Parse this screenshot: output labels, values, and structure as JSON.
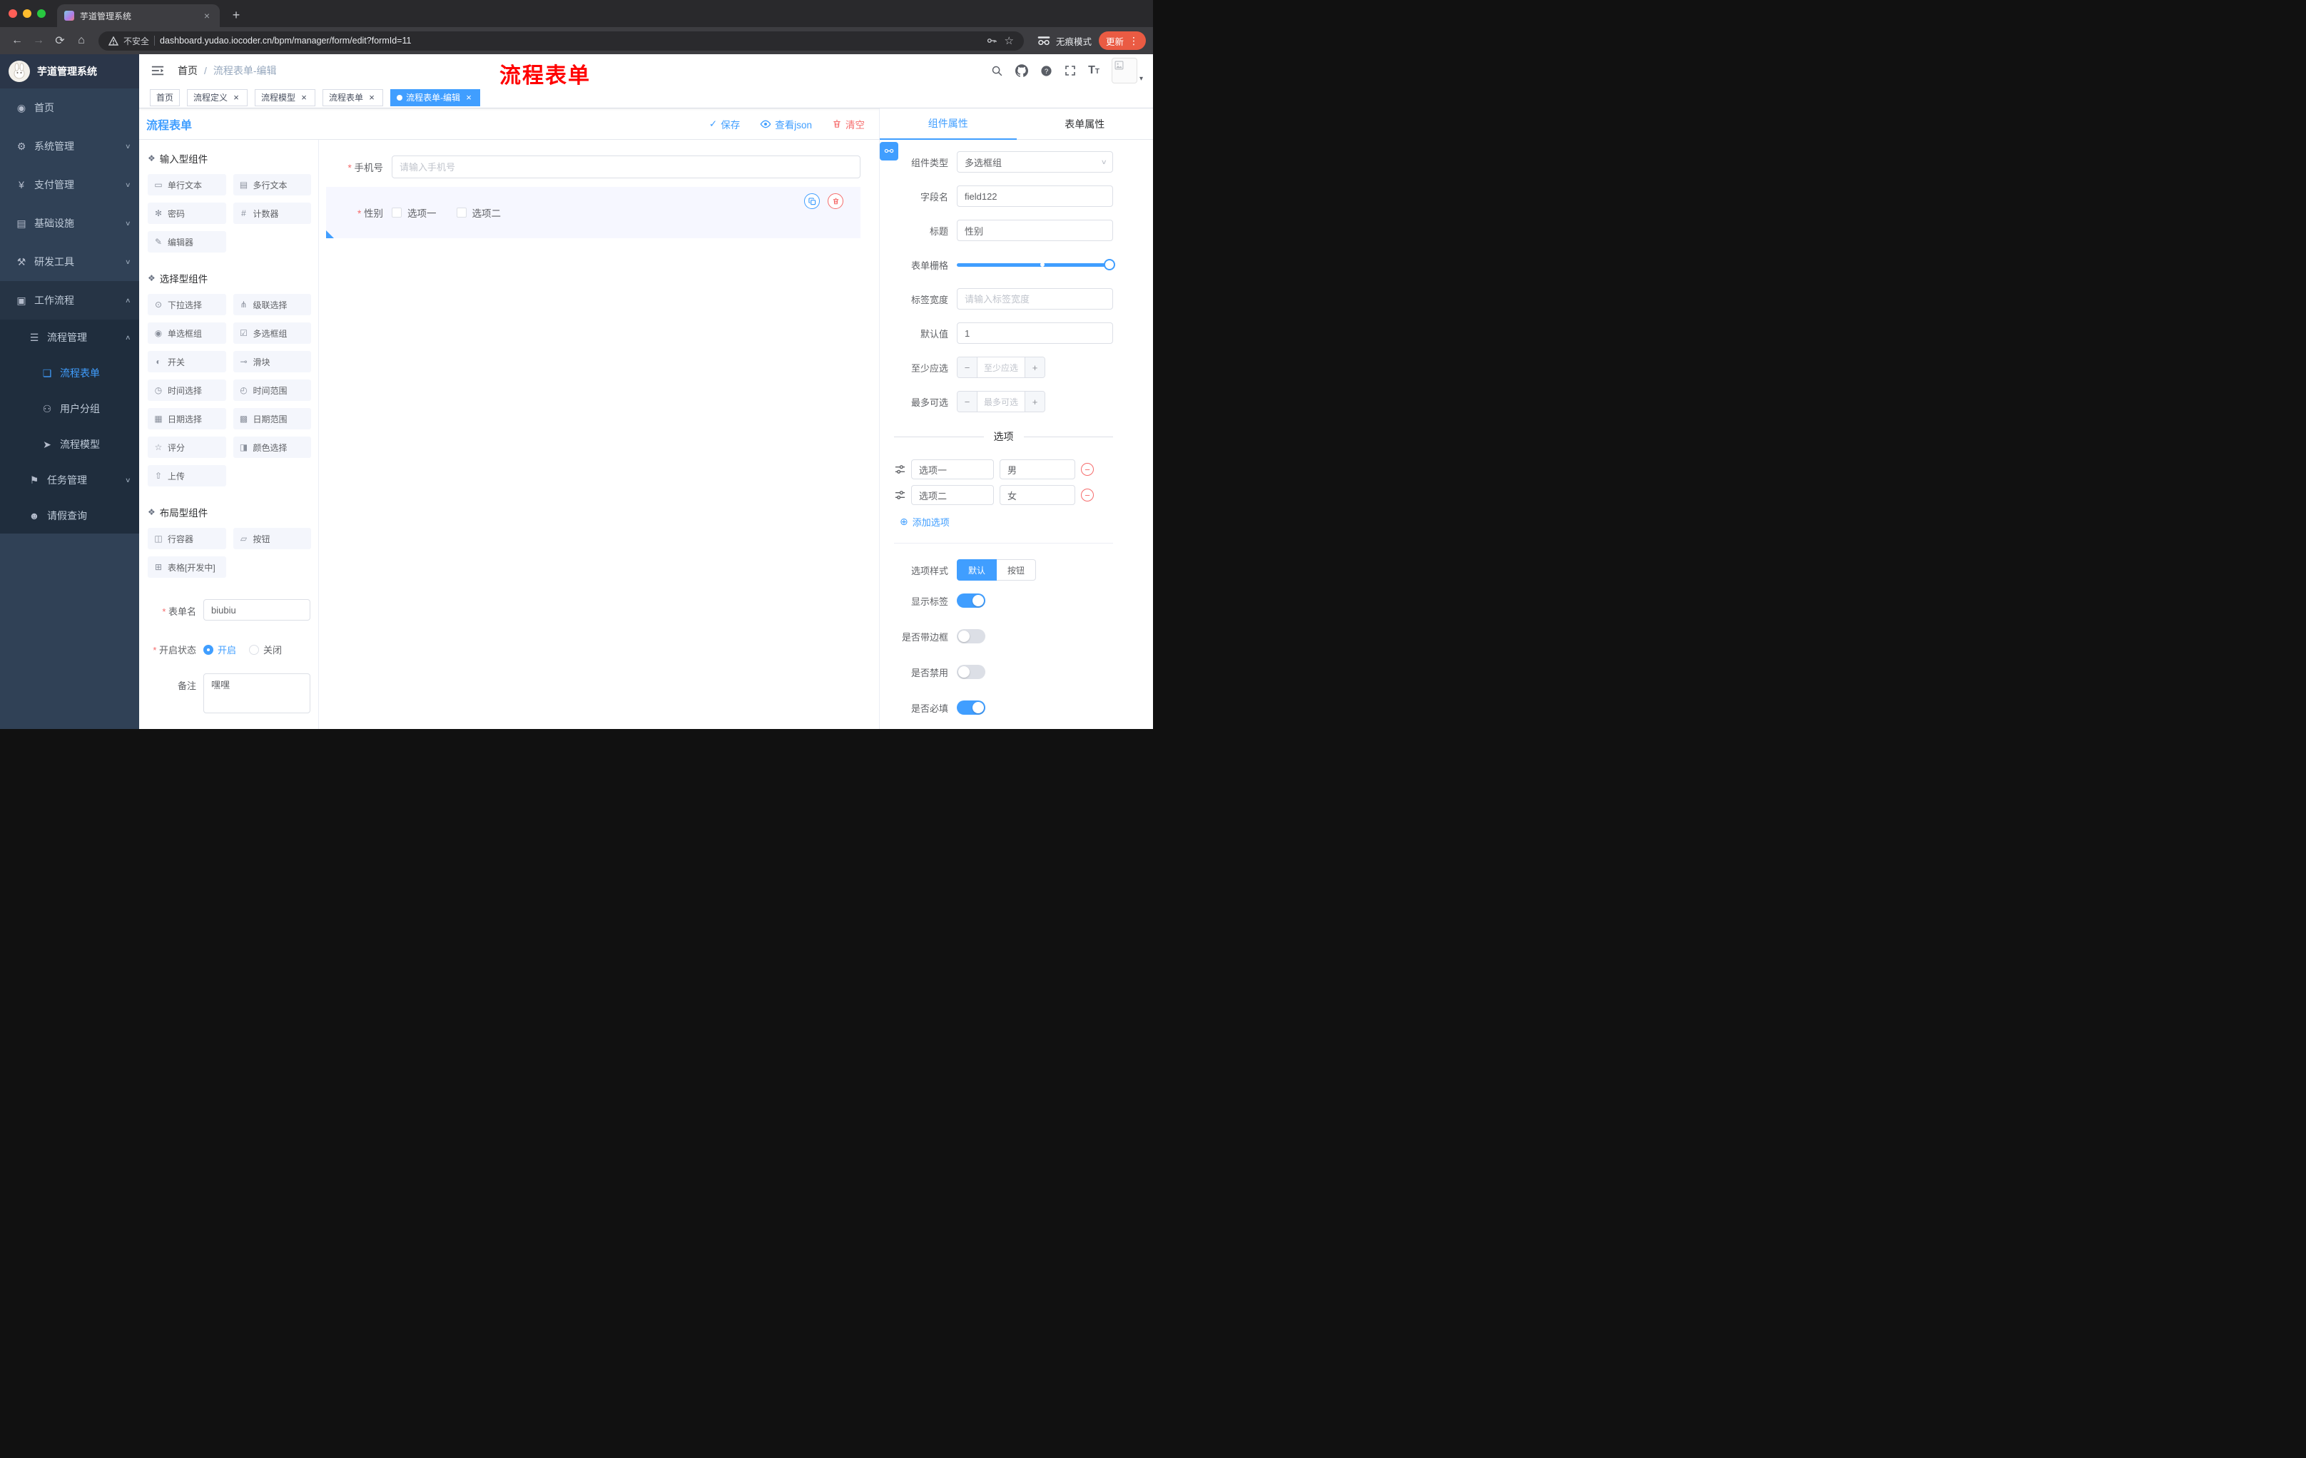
{
  "browser": {
    "tab_title": "芋道管理系统",
    "new_tab_label": "+",
    "security_label": "不安全",
    "url": "dashboard.yudao.iocoder.cn/bpm/manager/form/edit?formId=11",
    "incognito_label": "无痕模式",
    "update_label": "更新"
  },
  "sidebar": {
    "logo_title": "芋道管理系统",
    "items": [
      {
        "id": "home",
        "label": "首页",
        "icon": "home",
        "level": 1
      },
      {
        "id": "system",
        "label": "系统管理",
        "icon": "system",
        "level": 1,
        "chevron": "down"
      },
      {
        "id": "pay",
        "label": "支付管理",
        "icon": "pay",
        "level": 1,
        "chevron": "down"
      },
      {
        "id": "infra",
        "label": "基础设施",
        "icon": "infra",
        "level": 1,
        "chevron": "down"
      },
      {
        "id": "dev",
        "label": "研发工具",
        "icon": "dev",
        "level": 1,
        "chevron": "down"
      },
      {
        "id": "workflow",
        "label": "工作流程",
        "icon": "workflow",
        "level": 1,
        "chevron": "up",
        "open": true
      },
      {
        "id": "process-mgmt",
        "label": "流程管理",
        "icon": "process-mgmt",
        "level": 2,
        "chevron": "up"
      },
      {
        "id": "process-form",
        "label": "流程表单",
        "icon": "process-form",
        "level": 3,
        "active": true
      },
      {
        "id": "user-group",
        "label": "用户分组",
        "icon": "user-group",
        "level": 3
      },
      {
        "id": "process-model",
        "label": "流程模型",
        "icon": "process-model",
        "level": 3
      },
      {
        "id": "task-mgmt",
        "label": "任务管理",
        "icon": "task-mgmt",
        "level": 2,
        "chevron": "down"
      },
      {
        "id": "leave-query",
        "label": "请假查询",
        "icon": "leave-query",
        "level": 2
      }
    ]
  },
  "navbar": {
    "breadcrumb": [
      "首页",
      "流程表单-编辑"
    ],
    "annotation": "流程表单"
  },
  "tags": [
    {
      "label": "首页"
    },
    {
      "label": "流程定义",
      "closable": true
    },
    {
      "label": "流程模型",
      "closable": true
    },
    {
      "label": "流程表单",
      "closable": true
    },
    {
      "label": "流程表单-编辑",
      "closable": true,
      "active": true
    }
  ],
  "designer": {
    "title": "流程表单",
    "save_label": "保存",
    "view_json_label": "查看json",
    "clear_label": "清空",
    "palette_sections": [
      {
        "title": "输入型组件",
        "items": [
          {
            "id": "single-text",
            "label": "单行文本",
            "icon": "input"
          },
          {
            "id": "multi-text",
            "label": "多行文本",
            "icon": "textarea"
          },
          {
            "id": "password",
            "label": "密码",
            "icon": "password"
          },
          {
            "id": "counter",
            "label": "计数器",
            "icon": "counter"
          },
          {
            "id": "editor",
            "label": "编辑器",
            "icon": "editor"
          }
        ]
      },
      {
        "title": "选择型组件",
        "items": [
          {
            "id": "select",
            "label": "下拉选择",
            "icon": "select"
          },
          {
            "id": "cascader",
            "label": "级联选择",
            "icon": "cascader"
          },
          {
            "id": "radio-group",
            "label": "单选框组",
            "icon": "radio"
          },
          {
            "id": "checkbox-group",
            "label": "多选框组",
            "icon": "checkbox"
          },
          {
            "id": "switch",
            "label": "开关",
            "icon": "switch"
          },
          {
            "id": "slider",
            "label": "滑块",
            "icon": "slider"
          },
          {
            "id": "time-picker",
            "label": "时间选择",
            "icon": "time"
          },
          {
            "id": "time-range",
            "label": "时间范围",
            "icon": "time-range"
          },
          {
            "id": "date-picker",
            "label": "日期选择",
            "icon": "date"
          },
          {
            "id": "date-range",
            "label": "日期范围",
            "icon": "date-range"
          },
          {
            "id": "rate",
            "label": "评分",
            "icon": "rate"
          },
          {
            "id": "color-picker",
            "label": "颜色选择",
            "icon": "color"
          },
          {
            "id": "upload",
            "label": "上传",
            "icon": "upload"
          }
        ]
      },
      {
        "title": "布局型组件",
        "items": [
          {
            "id": "row-container",
            "label": "行容器",
            "icon": "row"
          },
          {
            "id": "button",
            "label": "按钮",
            "icon": "button"
          },
          {
            "id": "table",
            "label": "表格[开发中]",
            "icon": "table"
          }
        ]
      }
    ],
    "meta": {
      "form_name_label": "表单名",
      "form_name_value": "biubiu",
      "status_label": "开启状态",
      "status_on": "开启",
      "status_off": "关闭",
      "remark_label": "备注",
      "remark_value": "嘿嘿"
    },
    "canvas": {
      "phone_label": "手机号",
      "phone_placeholder": "请输入手机号",
      "gender_label": "性别",
      "gender_options": [
        "选项一",
        "选项二"
      ]
    }
  },
  "props": {
    "tabs": [
      "组件属性",
      "表单属性"
    ],
    "component_type_label": "组件类型",
    "component_type_value": "多选框组",
    "field_name_label": "字段名",
    "field_name_value": "field122",
    "title_label": "标题",
    "title_value": "性别",
    "grid_label": "表单栅格",
    "label_width_label": "标签宽度",
    "label_width_placeholder": "请输入标签宽度",
    "default_label": "默认值",
    "default_value": "1",
    "min_select_label": "至少应选",
    "min_select_placeholder": "至少应选",
    "max_select_label": "最多可选",
    "max_select_placeholder": "最多可选",
    "options_divider": "选项",
    "options": [
      {
        "label": "选项一",
        "value": "男"
      },
      {
        "label": "选项二",
        "value": "女"
      }
    ],
    "add_option_label": "添加选项",
    "option_style_label": "选项样式",
    "style_options": [
      {
        "id": "default",
        "label": "默认",
        "active": true
      },
      {
        "id": "button",
        "label": "按钮",
        "active": false
      }
    ],
    "switches": [
      {
        "id": "show-label",
        "label": "显示标签",
        "on": true
      },
      {
        "id": "bordered",
        "label": "是否带边框",
        "on": false
      },
      {
        "id": "disabled",
        "label": "是否禁用",
        "on": false
      },
      {
        "id": "required",
        "label": "是否必填",
        "on": true
      }
    ]
  },
  "colors": {
    "accent": "#409EFF",
    "danger": "#F56C6C",
    "sidebar_bg": "#304156",
    "submenu_bg": "#1f2d3d",
    "annotation_red": "#FF0000",
    "update_pill": "#EA5B43"
  }
}
